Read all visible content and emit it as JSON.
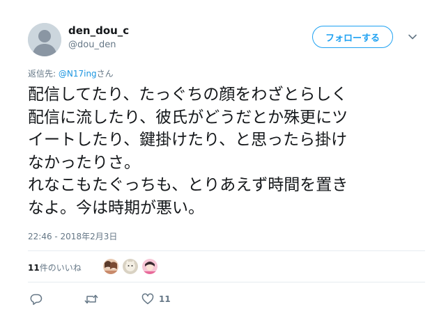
{
  "user": {
    "display_name": "den_dou_c",
    "screen_name": "@dou_den"
  },
  "follow_button": {
    "label": "フォローする"
  },
  "reply_context": {
    "prefix": "返信先: ",
    "mention": "@N17ing",
    "suffix": "さん"
  },
  "tweet": {
    "lines": [
      "配信してたり、たっぐちの顔をわざとらしく",
      "配信に流したり、彼氏がどうだとか殊更にツ",
      "イートしたり、鍵掛けたり、と思ったら掛け",
      "なかったりさ。",
      "れなこもたぐっちも、とりあえず時間を置き",
      "なよ。今は時期が悪い。"
    ]
  },
  "timestamp": "22:46 - 2018年2月3日",
  "likes": {
    "count": "11",
    "label": "件のいいね"
  },
  "actions": {
    "like_count": "11"
  },
  "colors": {
    "accent": "#1da1f2",
    "mention": "#1b95e0",
    "secondary_text": "#657786",
    "divider": "#e6ecf0"
  },
  "icons": [
    "default-avatar-icon",
    "chevron-down-icon",
    "reply-icon",
    "retweet-icon",
    "heart-icon"
  ]
}
